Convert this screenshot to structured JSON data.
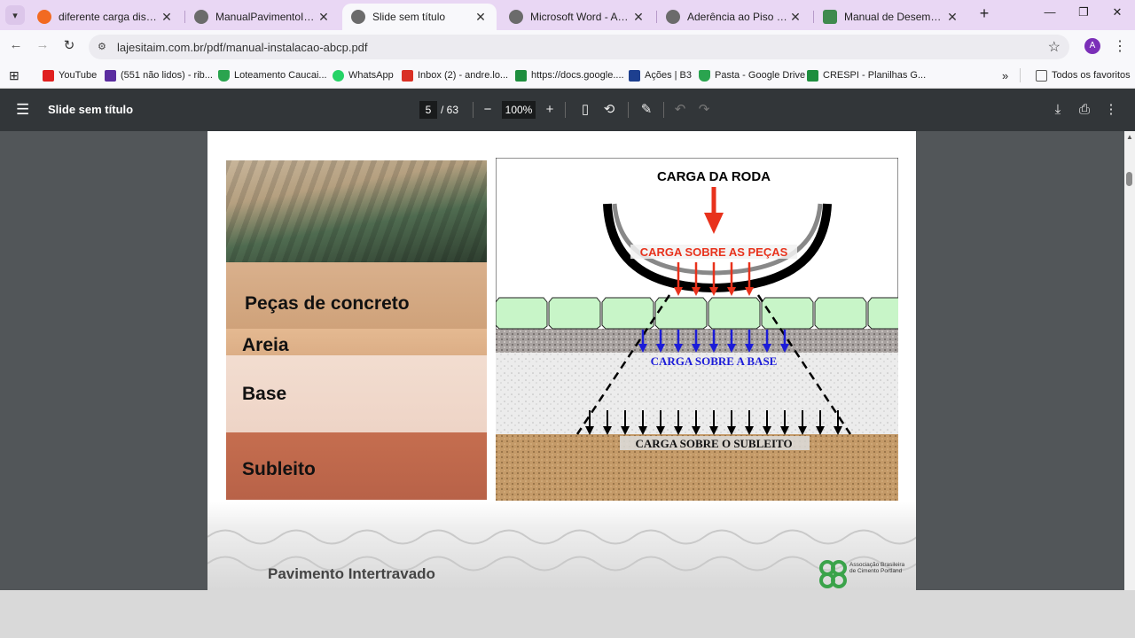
{
  "browser": {
    "tabs": [
      {
        "label": "diferente carga distribuição",
        "icon": "brave-icon",
        "active": false
      },
      {
        "label": "ManualPavimentoIntertrav",
        "icon": "globe-icon",
        "active": false
      },
      {
        "label": "Slide sem título",
        "icon": "globe-icon",
        "active": true
      },
      {
        "label": "Microsoft Word - AnpetXIV",
        "icon": "globe-icon",
        "active": false
      },
      {
        "label": "Aderência ao Piso | Ciência",
        "icon": "globe-icon",
        "active": false
      },
      {
        "label": "Manual de Desempenho p",
        "icon": "doc-icon",
        "active": false
      }
    ],
    "url": "lajesitaim.com.br/pdf/manual-instalacao-abcp.pdf",
    "avatar_letter": "A",
    "bookmarks": [
      {
        "label": "YouTube",
        "icon": "youtube-icon",
        "color": "#e02020"
      },
      {
        "label": "(551 não lidos) - rib...",
        "icon": "mail-icon",
        "color": "#5a2ca0"
      },
      {
        "label": "Loteamento Caucai...",
        "icon": "drive-icon",
        "color": "#2aa44f"
      },
      {
        "label": "WhatsApp",
        "icon": "whatsapp-icon",
        "color": "#25d366"
      },
      {
        "label": "Inbox (2) - andre.lo...",
        "icon": "gmail-icon",
        "color": "#d93025"
      },
      {
        "label": "https://docs.google....",
        "icon": "sheets-icon",
        "color": "#1e8e3e"
      },
      {
        "label": "Ações | B3",
        "icon": "b3-icon",
        "color": "#1d3f8f"
      },
      {
        "label": "Pasta - Google Drive",
        "icon": "drive-icon",
        "color": "#2aa44f"
      },
      {
        "label": "CRESPI - Planilhas G...",
        "icon": "sheets-icon",
        "color": "#1e8e3e"
      }
    ],
    "all_bookmarks_label": "Todos os favoritos"
  },
  "pdf_viewer": {
    "title": "Slide sem título",
    "current_page": "5",
    "total_pages": "/ 63",
    "zoom": "100%"
  },
  "slide": {
    "photo_labels": {
      "pecas": "Peças de concreto",
      "areia": "Areia",
      "base": "Base",
      "subleito": "Subleito"
    },
    "diagram_labels": {
      "carga_roda": "CARGA DA RODA",
      "carga_pecas": "CARGA SOBRE AS PEÇAS",
      "carga_base": "CARGA SOBRE A BASE",
      "carga_subleito": "CARGA SOBRE O SUBLEITO"
    },
    "footer_title": "Pavimento Intertravado",
    "logo_text": "Associação Brasileira de Cimento Portland",
    "colors": {
      "wheel_load_arrow": "#e8321c",
      "base_arrow": "#1c1cd8",
      "subgrade_arrow": "#000000",
      "paver_fill": "#c8f5c8",
      "logo_green": "#3aa34a"
    }
  }
}
